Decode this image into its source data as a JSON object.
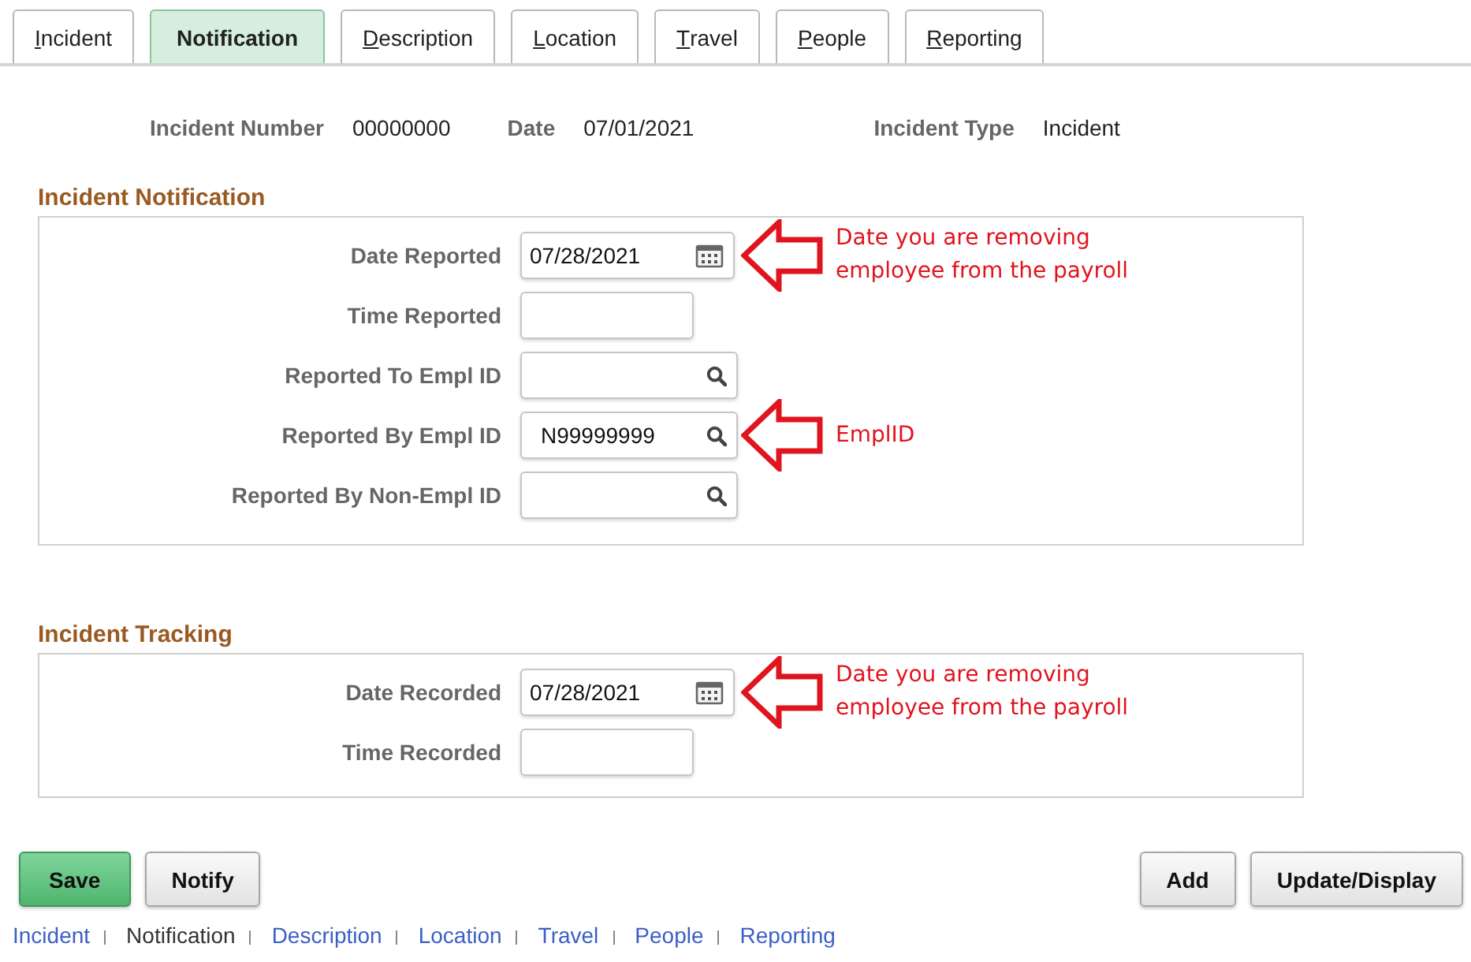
{
  "tabs": [
    {
      "label": "Incident",
      "selected": false
    },
    {
      "label": "Notification",
      "selected": true
    },
    {
      "label": "Description",
      "selected": false
    },
    {
      "label": "Location",
      "selected": false
    },
    {
      "label": "Travel",
      "selected": false
    },
    {
      "label": "People",
      "selected": false
    },
    {
      "label": "Reporting",
      "selected": false
    }
  ],
  "header_fields": [
    {
      "label": "Incident Number",
      "value": "00000000"
    },
    {
      "label": "Date",
      "value": "07/01/2021"
    },
    {
      "label": "Incident Type",
      "value": "Incident"
    }
  ],
  "sections": [
    {
      "title": "Incident Notification",
      "fields": [
        {
          "label": "Date Reported",
          "kind": "date",
          "value": "07/28/2021",
          "note": "Date you are removing employee from the payroll"
        },
        {
          "label": "Time Reported",
          "kind": "text"
        },
        {
          "label": "Reported To Empl ID",
          "kind": "lookup"
        },
        {
          "label": "Reported By Empl ID",
          "kind": "lookup",
          "value": "N99999999",
          "note": "EmplID"
        },
        {
          "label": "Reported By Non-Empl ID",
          "kind": "lookup"
        }
      ]
    },
    {
      "title": "Incident Tracking",
      "fields": [
        {
          "label": "Date Recorded",
          "kind": "date",
          "value": "07/28/2021",
          "note": "Date you are removing employee from the payroll"
        },
        {
          "label": "Time Recorded",
          "kind": "text"
        }
      ]
    }
  ],
  "buttons_left": [
    {
      "label": "Save",
      "primary": true
    },
    {
      "label": "Notify",
      "primary": false
    }
  ],
  "buttons_right": [
    {
      "label": "Add",
      "primary": false
    },
    {
      "label": "Update/Display",
      "primary": false
    }
  ],
  "footer_links": [
    {
      "label": "Incident",
      "selected": false
    },
    {
      "label": "Notification",
      "selected": true
    },
    {
      "label": "Description",
      "selected": false
    },
    {
      "label": "Location",
      "selected": false
    },
    {
      "label": "Travel",
      "selected": false
    },
    {
      "label": "People",
      "selected": false
    },
    {
      "label": "Reporting",
      "selected": false
    }
  ]
}
